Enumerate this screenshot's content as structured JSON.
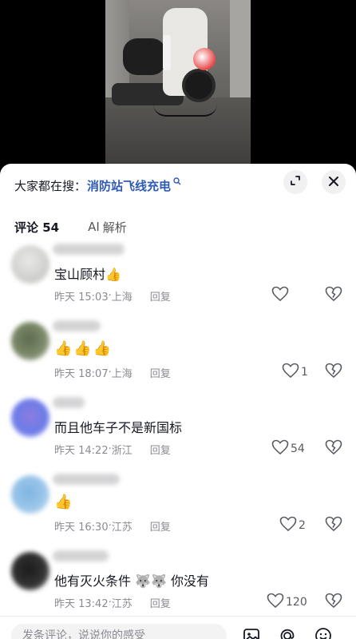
{
  "search": {
    "prefix": "大家都在搜：",
    "term": "消防站飞线充电"
  },
  "tabs": {
    "comments": "评论 54",
    "ai_prefix": "AI",
    "ai_label": "解析"
  },
  "comments": [
    {
      "text": "宝山顾村",
      "emoji": "👍",
      "time": "昨天 15:03",
      "location": "上海",
      "reply": "回复",
      "likes": ""
    },
    {
      "text": "",
      "emoji": "👍👍👍",
      "time": "昨天 18:07",
      "location": "上海",
      "reply": "回复",
      "likes": "1"
    },
    {
      "text": "而且他车子不是新国标",
      "emoji": "",
      "time": "昨天 14:22",
      "location": "浙江",
      "reply": "回复",
      "likes": "54"
    },
    {
      "text": "",
      "emoji": "👍",
      "time": "昨天 16:30",
      "location": "江苏",
      "reply": "回复",
      "likes": "2"
    },
    {
      "text": "他有灭火条件",
      "emoji": "🐺🐺",
      "text2": "你没有",
      "time": "昨天 13:42",
      "location": "江苏",
      "reply": "回复",
      "likes": "120"
    }
  ],
  "composer": {
    "placeholder": "发条评论，说说你的感受"
  },
  "icons": {
    "expand": "expand-icon",
    "close": "close-icon",
    "like": "heart-icon",
    "dislike": "broken-heart-icon",
    "image": "image-icon",
    "mention": "at-icon",
    "emoji": "emoji-icon"
  },
  "colors": {
    "search_term": "#2f5bb6",
    "text": "#161823",
    "meta": "#8a8b91"
  }
}
